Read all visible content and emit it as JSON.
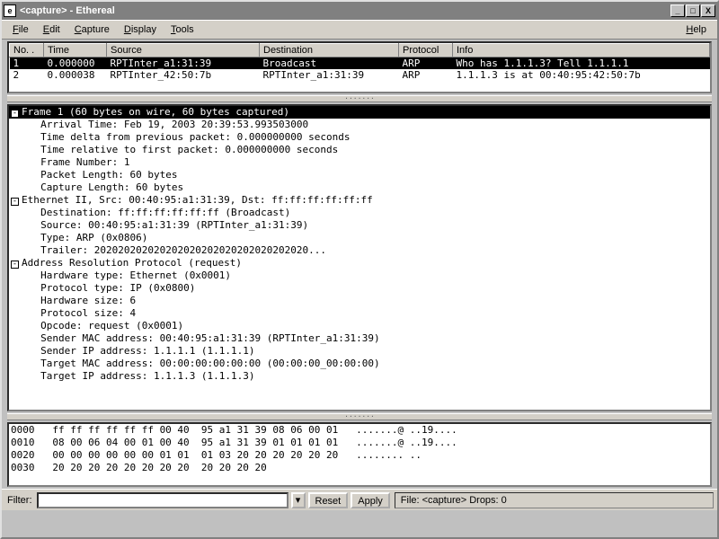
{
  "window": {
    "title": "<capture> - Ethereal",
    "icon_letter": "e"
  },
  "menu": {
    "file": "File",
    "edit": "Edit",
    "capture": "Capture",
    "display": "Display",
    "tools": "Tools",
    "help": "Help"
  },
  "packet_list": {
    "columns": {
      "no": "No. .",
      "time": "Time",
      "source": "Source",
      "destination": "Destination",
      "protocol": "Protocol",
      "info": "Info"
    },
    "rows": [
      {
        "no": "1",
        "time": "0.000000",
        "source": "RPTInter_a1:31:39",
        "destination": "Broadcast",
        "protocol": "ARP",
        "info": "Who has 1.1.1.3?  Tell 1.1.1.1",
        "selected": true
      },
      {
        "no": "2",
        "time": "0.000038",
        "source": "RPTInter_42:50:7b",
        "destination": "RPTInter_a1:31:39",
        "protocol": "ARP",
        "info": "1.1.1.3 is at 00:40:95:42:50:7b",
        "selected": false
      }
    ]
  },
  "detail": {
    "frame_header": "Frame 1 (60 bytes on wire, 60 bytes captured)",
    "arrival": "Arrival Time: Feb 19, 2003 20:39:53.993503000",
    "delta": "Time delta from previous packet: 0.000000000 seconds",
    "relative": "Time relative to first packet: 0.000000000 seconds",
    "frame_no": "Frame Number: 1",
    "pkt_len": "Packet Length: 60 bytes",
    "cap_len": "Capture Length: 60 bytes",
    "eth_header": "Ethernet II, Src: 00:40:95:a1:31:39, Dst: ff:ff:ff:ff:ff:ff",
    "eth_dst": "Destination: ff:ff:ff:ff:ff:ff (Broadcast)",
    "eth_src": "Source: 00:40:95:a1:31:39 (RPTInter_a1:31:39)",
    "eth_type": "Type: ARP (0x0806)",
    "eth_trailer": "Trailer: 202020202020202020202020202020202020...",
    "arp_header": "Address Resolution Protocol (request)",
    "arp_hw": "Hardware type: Ethernet (0x0001)",
    "arp_proto": "Protocol type: IP (0x0800)",
    "arp_hwsize": "Hardware size: 6",
    "arp_psize": "Protocol size: 4",
    "arp_opcode": "Opcode: request (0x0001)",
    "arp_smac": "Sender MAC address: 00:40:95:a1:31:39 (RPTInter_a1:31:39)",
    "arp_sip": "Sender IP address: 1.1.1.1 (1.1.1.1)",
    "arp_tmac": "Target MAC address: 00:00:00:00:00:00 (00:00:00_00:00:00)",
    "arp_tip": "Target IP address: 1.1.1.3 (1.1.1.3)"
  },
  "hex": {
    "l0": "0000   ff ff ff ff ff ff 00 40  95 a1 31 39 08 06 00 01   .......@ ..19....",
    "l1": "0010   08 00 06 04 00 01 00 40  95 a1 31 39 01 01 01 01   .......@ ..19....",
    "l2": "0020   00 00 00 00 00 00 01 01  01 03 20 20 20 20 20 20   ........ ..",
    "l3": "0030   20 20 20 20 20 20 20 20  20 20 20 20"
  },
  "bottombar": {
    "filter_label": "Filter:",
    "filter_value": "",
    "reset": "Reset",
    "apply": "Apply",
    "status": "File: <capture> Drops: 0"
  }
}
